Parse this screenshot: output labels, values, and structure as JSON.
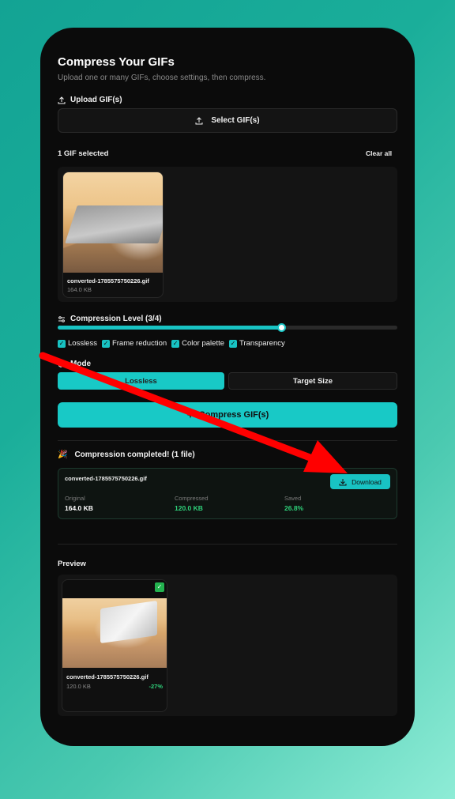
{
  "page": {
    "title": "Compress Your GIFs",
    "subtitle": "Upload one or many GIFs, choose settings, then compress."
  },
  "upload": {
    "label": "Upload GIF(s)",
    "button_label": "Select GIF(s)"
  },
  "selection": {
    "count_label": "1 GIF selected",
    "clear_all_label": "Clear all",
    "files": [
      {
        "name": "converted-1785575750226.gif",
        "size": "164.0 KB"
      }
    ]
  },
  "compression": {
    "level_label": "Compression Level (3/4)",
    "level": 3,
    "level_max": 4,
    "level_fraction": 0.66,
    "options": [
      {
        "label": "Lossless",
        "checked": true
      },
      {
        "label": "Frame reduction",
        "checked": true
      },
      {
        "label": "Color palette",
        "checked": true
      },
      {
        "label": "Transparency",
        "checked": true
      }
    ]
  },
  "mode": {
    "label": "Mode",
    "options": [
      "Lossless",
      "Target Size"
    ],
    "selected": "Lossless"
  },
  "compress_button": {
    "label": "Compress GIF(s)",
    "icon": "sparkle-icon"
  },
  "result": {
    "status_icon": "🎉",
    "status": "Compression completed! (1 file)",
    "file_name": "converted-1785575750226.gif",
    "download_label": "Download",
    "stats": [
      {
        "key": "Original",
        "value": "164.0 KB",
        "color": "#ffffff"
      },
      {
        "key": "Compressed",
        "value": "120.0 KB",
        "color": "#2fd17a"
      },
      {
        "key": "Saved",
        "value": "26.8%",
        "color": "#2fd17a"
      }
    ]
  },
  "preview": {
    "label": "Preview",
    "file_name": "converted-1785575750226.gif",
    "size": "120.0 KB",
    "delta": "-27%",
    "check": "✓"
  },
  "colors": {
    "accent": "#18c9c6",
    "success": "#2fd17a",
    "annotation_arrow": "#ff0000"
  }
}
